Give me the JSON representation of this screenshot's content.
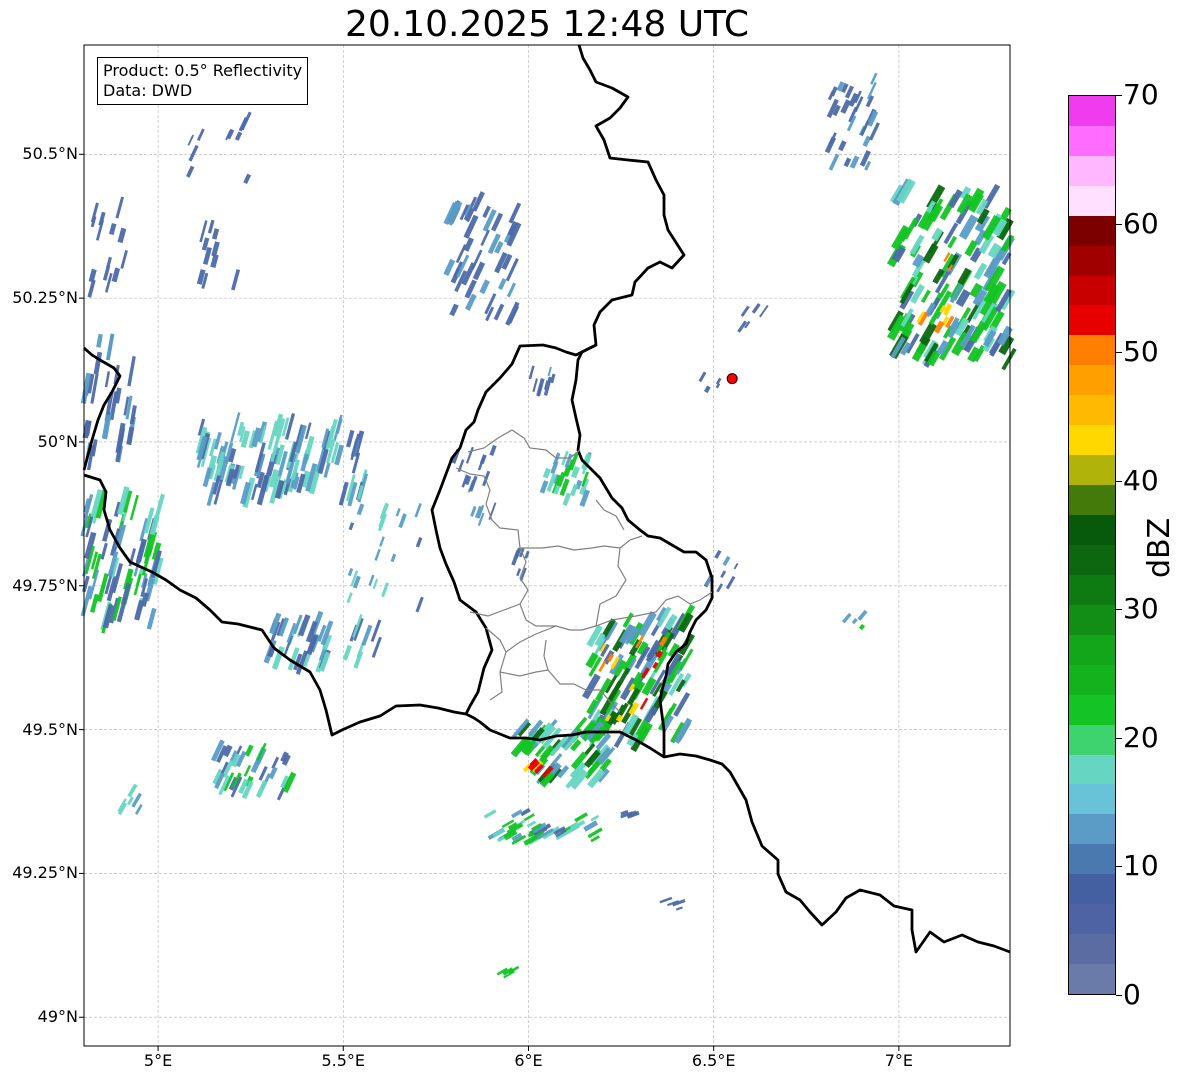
{
  "title": "20.10.2025 12:48 UTC",
  "info_box": {
    "product_line": "Product: 0.5° Reflectivity",
    "data_line": "Data: DWD"
  },
  "axes": {
    "lon_range": [
      4.8,
      7.3
    ],
    "lat_range": [
      48.95,
      50.69
    ],
    "x_ticks": [
      {
        "value": 5.0,
        "label": "5°E"
      },
      {
        "value": 5.5,
        "label": "5.5°E"
      },
      {
        "value": 6.0,
        "label": "6°E"
      },
      {
        "value": 6.5,
        "label": "6.5°E"
      },
      {
        "value": 7.0,
        "label": "7°E"
      }
    ],
    "y_ticks": [
      {
        "value": 50.5,
        "label": "50.5°N"
      },
      {
        "value": 50.25,
        "label": "50.25°N"
      },
      {
        "value": 50.0,
        "label": "50°N"
      },
      {
        "value": 49.75,
        "label": "49.75°N"
      },
      {
        "value": 49.5,
        "label": "49.5°N"
      },
      {
        "value": 49.25,
        "label": "49.25°N"
      },
      {
        "value": 49.0,
        "label": "49°N"
      }
    ],
    "gridlines": true
  },
  "marker": {
    "lon": 6.55,
    "lat": 50.11,
    "color": "#ff0000"
  },
  "colorbar": {
    "label": "dBZ",
    "range": [
      0,
      70
    ],
    "ticks": [
      {
        "value": 0,
        "label": "0"
      },
      {
        "value": 10,
        "label": "10"
      },
      {
        "value": 20,
        "label": "20"
      },
      {
        "value": 30,
        "label": "30"
      },
      {
        "value": 40,
        "label": "40"
      },
      {
        "value": 50,
        "label": "50"
      },
      {
        "value": 60,
        "label": "60"
      },
      {
        "value": 70,
        "label": "70"
      }
    ],
    "colors": [
      "#6a7aa9",
      "#5a6ca2",
      "#4d63a4",
      "#4460a0",
      "#4a79b0",
      "#5a9cc6",
      "#68c3d9",
      "#66d6c2",
      "#3fd370",
      "#13c424",
      "#12b31d",
      "#13a51a",
      "#128d15",
      "#0e7a12",
      "#0c6710",
      "#075a0c",
      "#447a0a",
      "#b0b40a",
      "#ffd800",
      "#ffba00",
      "#ffa000",
      "#ff8000",
      "#e60000",
      "#c80000",
      "#a00000",
      "#7c0000",
      "#ffe0ff",
      "#ffb8ff",
      "#ff6cff",
      "#ee3cee"
    ]
  },
  "echo_colors": {
    "light": "#4d6aa8",
    "mid": "#5a9cc6",
    "cyan": "#66d6c2",
    "green": "#13c424",
    "darkgreen": "#0c6710",
    "yellow": "#ffd800",
    "orange": "#ff8000",
    "red": "#e60000"
  },
  "map": {
    "background": "#ffffff",
    "border_color": "#000000",
    "province_color": "#808080"
  }
}
